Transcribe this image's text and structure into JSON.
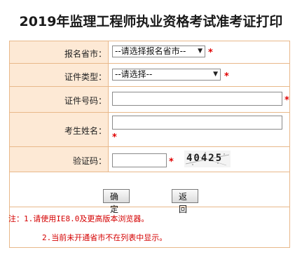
{
  "page_title": "2019年监理工程师执业资格考试准考证打印",
  "form": {
    "province_label": "报名省市：",
    "province_selected": "--请选择报名省市--",
    "id_type_label": "证件类型：",
    "id_type_selected": "--请选择--",
    "id_number_label": "证件号码：",
    "id_number_value": "",
    "name_label": "考生姓名：",
    "name_value": "",
    "captcha_label": "验证码：",
    "captcha_value": "",
    "captcha_image_text": "40425",
    "required_mark": "*"
  },
  "buttons": {
    "confirm": "确定",
    "back": "返回"
  },
  "notes": {
    "line1": "注：1.请使用IE8.0及更高版本浏览器。",
    "line2": "2.当前未开通省市不在列表中显示。"
  },
  "colors": {
    "label_bg": "#fde9d5",
    "border": "#e8b88a",
    "required": "#e00000"
  }
}
